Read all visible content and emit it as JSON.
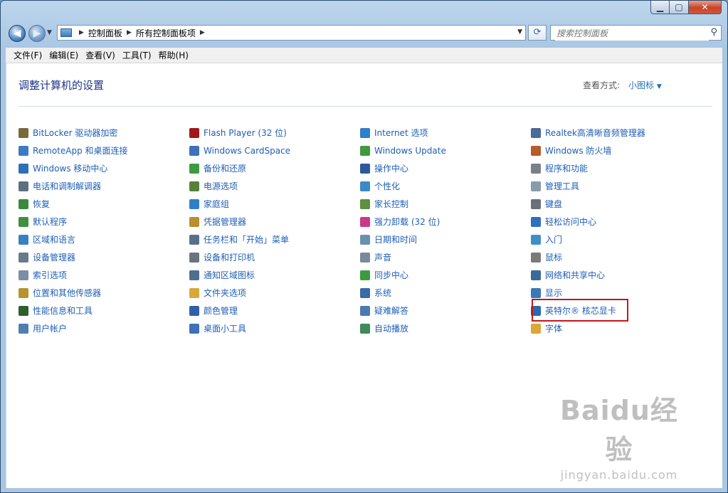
{
  "address": {
    "crumbs": [
      "控制面板",
      "所有控制面板项"
    ]
  },
  "search": {
    "placeholder": "搜索控制面板"
  },
  "menu": [
    "文件(F)",
    "编辑(E)",
    "查看(V)",
    "工具(T)",
    "帮助(H)"
  ],
  "header": {
    "title": "调整计算机的设置",
    "view_label": "查看方式:",
    "view_value": "小图标"
  },
  "columns": [
    [
      {
        "label": "BitLocker 驱动器加密",
        "icon": "bitlocker-icon",
        "color": "#7a6a3a"
      },
      {
        "label": "RemoteApp 和桌面连接",
        "icon": "remoteapp-icon",
        "color": "#3d7bc4"
      },
      {
        "label": "Windows 移动中心",
        "icon": "mobility-center-icon",
        "color": "#2f6fb8"
      },
      {
        "label": "电话和调制解调器",
        "icon": "phone-modem-icon",
        "color": "#5f6f80"
      },
      {
        "label": "恢复",
        "icon": "recovery-icon",
        "color": "#3b8a3b"
      },
      {
        "label": "默认程序",
        "icon": "default-programs-icon",
        "color": "#3f8f3f"
      },
      {
        "label": "区域和语言",
        "icon": "region-language-icon",
        "color": "#3a7fc2"
      },
      {
        "label": "设备管理器",
        "icon": "device-manager-icon",
        "color": "#6a7a8a"
      },
      {
        "label": "索引选项",
        "icon": "indexing-icon",
        "color": "#7a8fa3"
      },
      {
        "label": "位置和其他传感器",
        "icon": "location-sensor-icon",
        "color": "#b8922f"
      },
      {
        "label": "性能信息和工具",
        "icon": "performance-icon",
        "color": "#2f5e2f"
      },
      {
        "label": "用户帐户",
        "icon": "user-accounts-icon",
        "color": "#4f7fb0"
      }
    ],
    [
      {
        "label": "Flash Player (32 位)",
        "icon": "flash-player-icon",
        "color": "#a01818"
      },
      {
        "label": "Windows CardSpace",
        "icon": "cardspace-icon",
        "color": "#4070b8"
      },
      {
        "label": "备份和还原",
        "icon": "backup-icon",
        "color": "#3f9a3f"
      },
      {
        "label": "电源选项",
        "icon": "power-icon",
        "color": "#5a7f3a"
      },
      {
        "label": "家庭组",
        "icon": "homegroup-icon",
        "color": "#2f7fc8"
      },
      {
        "label": "凭据管理器",
        "icon": "credential-icon",
        "color": "#b8902f"
      },
      {
        "label": "任务栏和「开始」菜单",
        "icon": "taskbar-icon",
        "color": "#58708a"
      },
      {
        "label": "设备和打印机",
        "icon": "printer-icon",
        "color": "#6a7480"
      },
      {
        "label": "通知区域图标",
        "icon": "notification-icon",
        "color": "#4f6f90"
      },
      {
        "label": "文件夹选项",
        "icon": "folder-options-icon",
        "color": "#d8a838"
      },
      {
        "label": "颜色管理",
        "icon": "color-management-icon",
        "color": "#3060a8"
      },
      {
        "label": "桌面小工具",
        "icon": "gadgets-icon",
        "color": "#3f70b8"
      }
    ],
    [
      {
        "label": "Internet 选项",
        "icon": "internet-options-icon",
        "color": "#2f7fc8"
      },
      {
        "label": "Windows Update",
        "icon": "windows-update-icon",
        "color": "#3f9a3f"
      },
      {
        "label": "操作中心",
        "icon": "action-center-icon",
        "color": "#2a5a9a"
      },
      {
        "label": "个性化",
        "icon": "personalization-icon",
        "color": "#3a8ac8"
      },
      {
        "label": "家长控制",
        "icon": "parental-controls-icon",
        "color": "#5f8f3f"
      },
      {
        "label": "强力卸载 (32 位)",
        "icon": "uninstaller-icon",
        "color": "#c83a8a"
      },
      {
        "label": "日期和时间",
        "icon": "datetime-icon",
        "color": "#6a8fb0"
      },
      {
        "label": "声音",
        "icon": "sound-icon",
        "color": "#7a8a9a"
      },
      {
        "label": "同步中心",
        "icon": "sync-center-icon",
        "color": "#3f9a3f"
      },
      {
        "label": "系统",
        "icon": "system-icon",
        "color": "#3a6aa8"
      },
      {
        "label": "疑难解答",
        "icon": "troubleshooting-icon",
        "color": "#4a7ab0"
      },
      {
        "label": "自动播放",
        "icon": "autoplay-icon",
        "color": "#3f8a5a"
      }
    ],
    [
      {
        "label": "Realtek高清晰音频管理器",
        "icon": "realtek-audio-icon",
        "color": "#4a6a9a"
      },
      {
        "label": "Windows 防火墙",
        "icon": "firewall-icon",
        "color": "#b85a2a"
      },
      {
        "label": "程序和功能",
        "icon": "programs-features-icon",
        "color": "#7a7f8a"
      },
      {
        "label": "管理工具",
        "icon": "admin-tools-icon",
        "color": "#8a9aa8"
      },
      {
        "label": "键盘",
        "icon": "keyboard-icon",
        "color": "#6a7078"
      },
      {
        "label": "轻松访问中心",
        "icon": "ease-of-access-icon",
        "color": "#2f6fc0"
      },
      {
        "label": "入门",
        "icon": "getting-started-icon",
        "color": "#3f8fc8"
      },
      {
        "label": "鼠标",
        "icon": "mouse-icon",
        "color": "#7a7a7a"
      },
      {
        "label": "网络和共享中心",
        "icon": "network-sharing-icon",
        "color": "#3a6a9a"
      },
      {
        "label": "显示",
        "icon": "display-icon",
        "color": "#3a78b8"
      },
      {
        "label": "英特尔® 核芯显卡",
        "icon": "intel-graphics-icon",
        "color": "#2a6ab0"
      },
      {
        "label": "字体",
        "icon": "fonts-icon",
        "color": "#d8a838"
      }
    ]
  ],
  "watermark": {
    "logo": "Baidu经验",
    "url": "jingyan.baidu.com"
  }
}
